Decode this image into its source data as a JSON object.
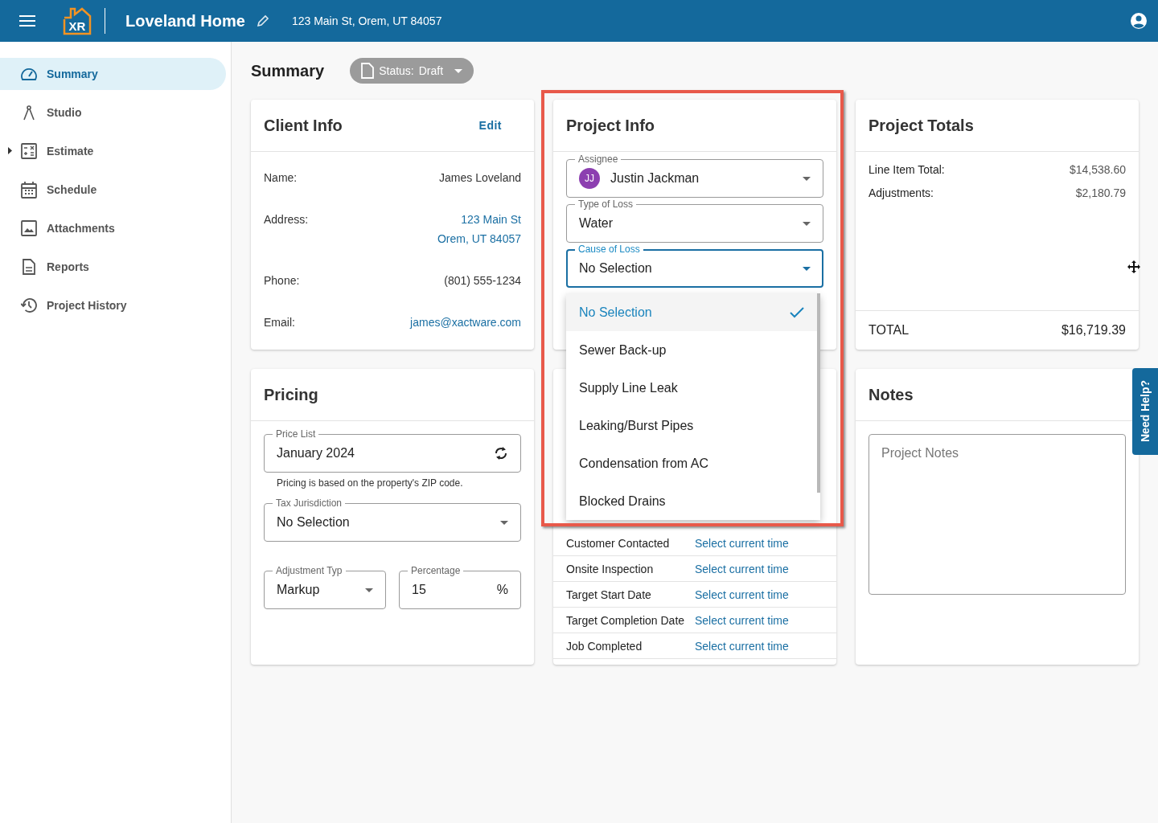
{
  "header": {
    "logo": "XR",
    "title": "Loveland Home",
    "address": "123 Main St, Orem, UT 84057"
  },
  "sidebar": {
    "items": [
      {
        "label": "Summary",
        "kind": "gauge",
        "selected": true,
        "expandable": false
      },
      {
        "label": "Studio",
        "kind": "compass",
        "selected": false,
        "expandable": false
      },
      {
        "label": "Estimate",
        "kind": "calculator",
        "selected": false,
        "expandable": true
      },
      {
        "label": "Schedule",
        "kind": "calendar",
        "selected": false,
        "expandable": false
      },
      {
        "label": "Attachments",
        "kind": "image",
        "selected": false,
        "expandable": false
      },
      {
        "label": "Reports",
        "kind": "document",
        "selected": false,
        "expandable": false
      },
      {
        "label": "Project History",
        "kind": "history",
        "selected": false,
        "expandable": false
      }
    ]
  },
  "page": {
    "title": "Summary",
    "status": {
      "label": "Status:",
      "value": "Draft"
    }
  },
  "client_info": {
    "title": "Client Info",
    "action": "Edit",
    "fields": [
      {
        "label": "Name:",
        "kind": "text",
        "lines": [
          "James Loveland"
        ]
      },
      {
        "label": "Address:",
        "kind": "link",
        "lines": [
          "123 Main St",
          "Orem, UT 84057"
        ]
      },
      {
        "label": "Phone:",
        "kind": "text",
        "lines": [
          "(801) 555-1234"
        ]
      },
      {
        "label": "Email:",
        "kind": "link",
        "lines": [
          "james@xactware.com"
        ]
      }
    ]
  },
  "project_info": {
    "title": "Project Info",
    "fields": [
      {
        "label": "Assignee",
        "value": "Justin Jackman",
        "avatar": "JJ",
        "focused": false
      },
      {
        "label": "Type of Loss",
        "value": "Water",
        "focused": false
      },
      {
        "label": "Cause of Loss",
        "value": "No Selection",
        "focused": true
      }
    ],
    "menu": {
      "options": [
        {
          "label": "No Selection",
          "selected": true
        },
        {
          "label": "Sewer Back-up",
          "selected": false
        },
        {
          "label": "Supply Line Leak",
          "selected": false
        },
        {
          "label": "Leaking/Burst Pipes",
          "selected": false
        },
        {
          "label": "Condensation from AC",
          "selected": false
        },
        {
          "label": "Blocked Drains",
          "selected": false
        }
      ]
    }
  },
  "dates": {
    "rows": [
      {
        "label": "Customer Contacted",
        "action": "Select current time"
      },
      {
        "label": "Onsite Inspection",
        "action": "Select current time"
      },
      {
        "label": "Target Start Date",
        "action": "Select current time"
      },
      {
        "label": "Target Completion Date",
        "action": "Select current time"
      },
      {
        "label": "Job Completed",
        "action": "Select current time"
      }
    ]
  },
  "totals": {
    "title": "Project Totals",
    "lines": [
      {
        "label": "Line Item Total:",
        "value": "$14,538.60"
      },
      {
        "label": "Adjustments:",
        "value": "$2,180.79"
      }
    ],
    "total": {
      "label": "TOTAL",
      "value": "$16,719.39"
    }
  },
  "pricing": {
    "title": "Pricing",
    "price_list": {
      "label": "Price List",
      "value": "January 2024"
    },
    "helper": "Pricing is based on the property's ZIP code.",
    "tax": {
      "label": "Tax Jurisdiction",
      "value": "No Selection"
    },
    "adjustment_type": {
      "label": "Adjustment Typ",
      "value": "Markup"
    },
    "percentage": {
      "label": "Percentage",
      "value": "15",
      "suffix": "%"
    }
  },
  "notes": {
    "title": "Notes",
    "placeholder": "Project Notes"
  },
  "help": {
    "label": "Need Help?"
  }
}
